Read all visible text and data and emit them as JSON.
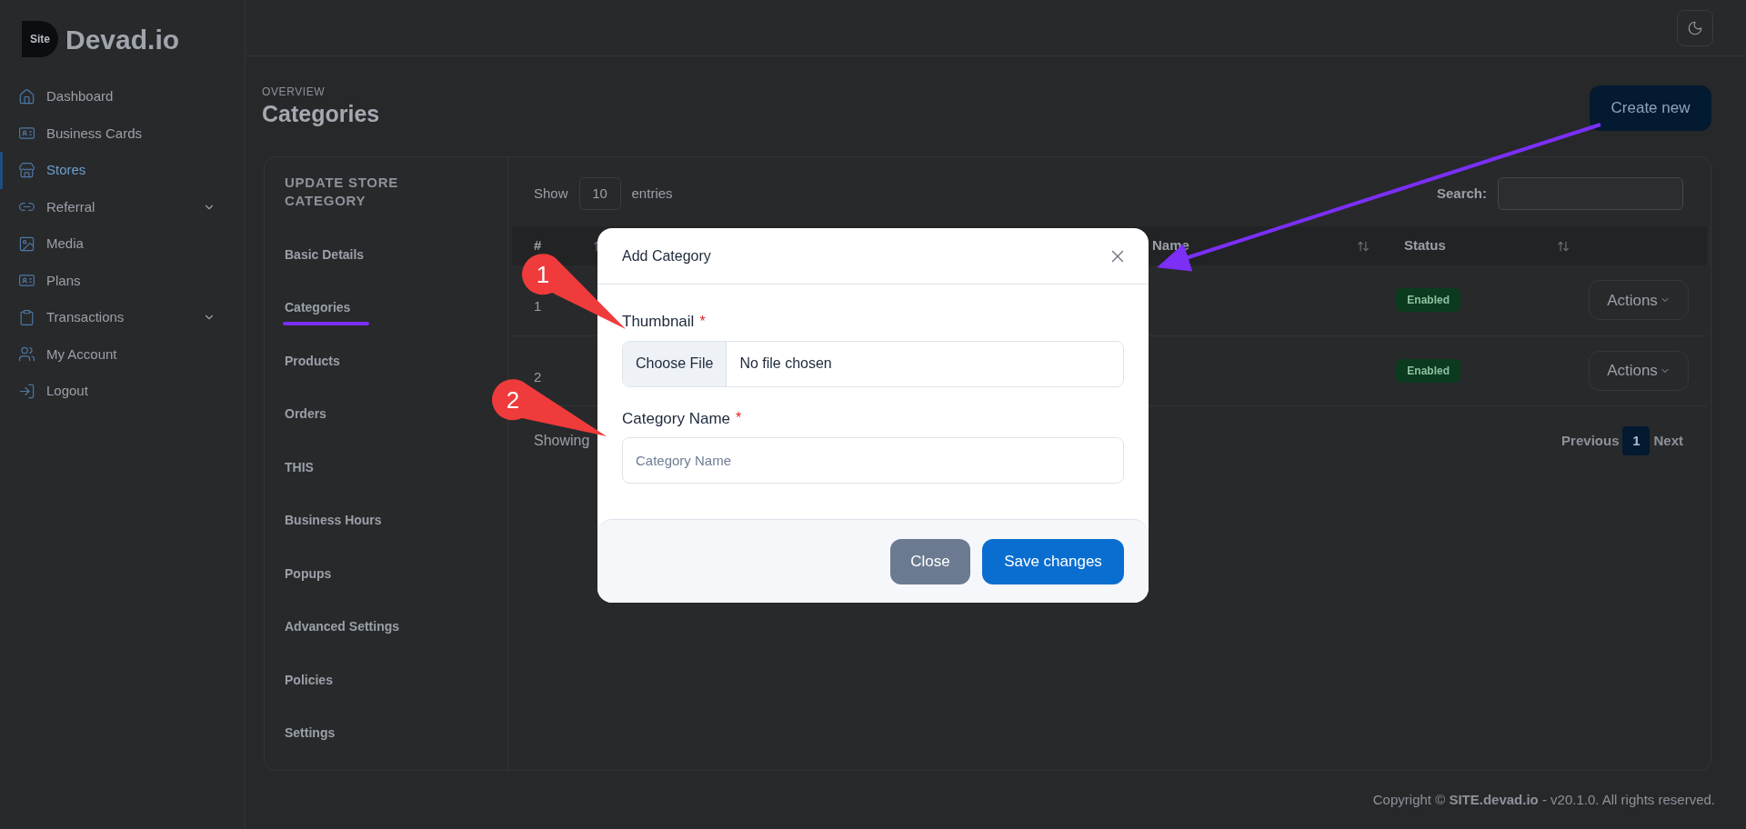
{
  "logo": {
    "badge": "Site",
    "name": "Devad.io"
  },
  "sidebar": {
    "items": [
      {
        "label": "Dashboard",
        "selected": false,
        "expandable": false
      },
      {
        "label": "Business Cards",
        "selected": false,
        "expandable": false
      },
      {
        "label": "Stores",
        "selected": true,
        "expandable": false
      },
      {
        "label": "Referral",
        "selected": false,
        "expandable": true
      },
      {
        "label": "Media",
        "selected": false,
        "expandable": false
      },
      {
        "label": "Plans",
        "selected": false,
        "expandable": false
      },
      {
        "label": "Transactions",
        "selected": false,
        "expandable": true
      },
      {
        "label": "My Account",
        "selected": false,
        "expandable": false
      },
      {
        "label": "Logout",
        "selected": false,
        "expandable": false
      }
    ]
  },
  "page": {
    "overline": "OVERVIEW",
    "title": "Categories",
    "create_button": "Create new"
  },
  "store_panel": {
    "title": "UPDATE STORE CATEGORY",
    "items": [
      "Basic Details",
      "Categories",
      "Products",
      "Orders",
      "THIS",
      "Business Hours",
      "Popups",
      "Advanced Settings",
      "Policies",
      "Settings"
    ]
  },
  "table": {
    "show_label": "Show",
    "page_size": "10",
    "entries_label": "entries",
    "search_label": "Search:",
    "columns": [
      {
        "label": "#"
      },
      {
        "label": "Name"
      },
      {
        "label": "Status"
      }
    ],
    "rows": [
      {
        "number": "1",
        "status": "Enabled",
        "action": "Actions"
      },
      {
        "number": "2",
        "status": "Enabled",
        "action": "Actions"
      }
    ],
    "info": "Showing",
    "pagination": {
      "previous": "Previous",
      "pages": [
        {
          "label": "1",
          "selected": true
        }
      ],
      "next": "Next"
    }
  },
  "modal": {
    "title": "Add Category",
    "fields": [
      {
        "kind": "file",
        "label": "Thumbnail",
        "required_mark": "*",
        "button": "Choose File",
        "value": "No file chosen"
      },
      {
        "kind": "text",
        "label": "Category Name",
        "required_mark": "*",
        "placeholder": "Category Name"
      }
    ],
    "buttons": [
      {
        "label": "Close",
        "kind": "secondary"
      },
      {
        "label": "Save changes",
        "kind": "primary"
      }
    ]
  },
  "annotations": {
    "callouts": [
      {
        "label": "1"
      },
      {
        "label": "2"
      }
    ]
  },
  "footer": "Copyright © **SITE.devad.io** - v20.1.0. All rights reserved."
}
